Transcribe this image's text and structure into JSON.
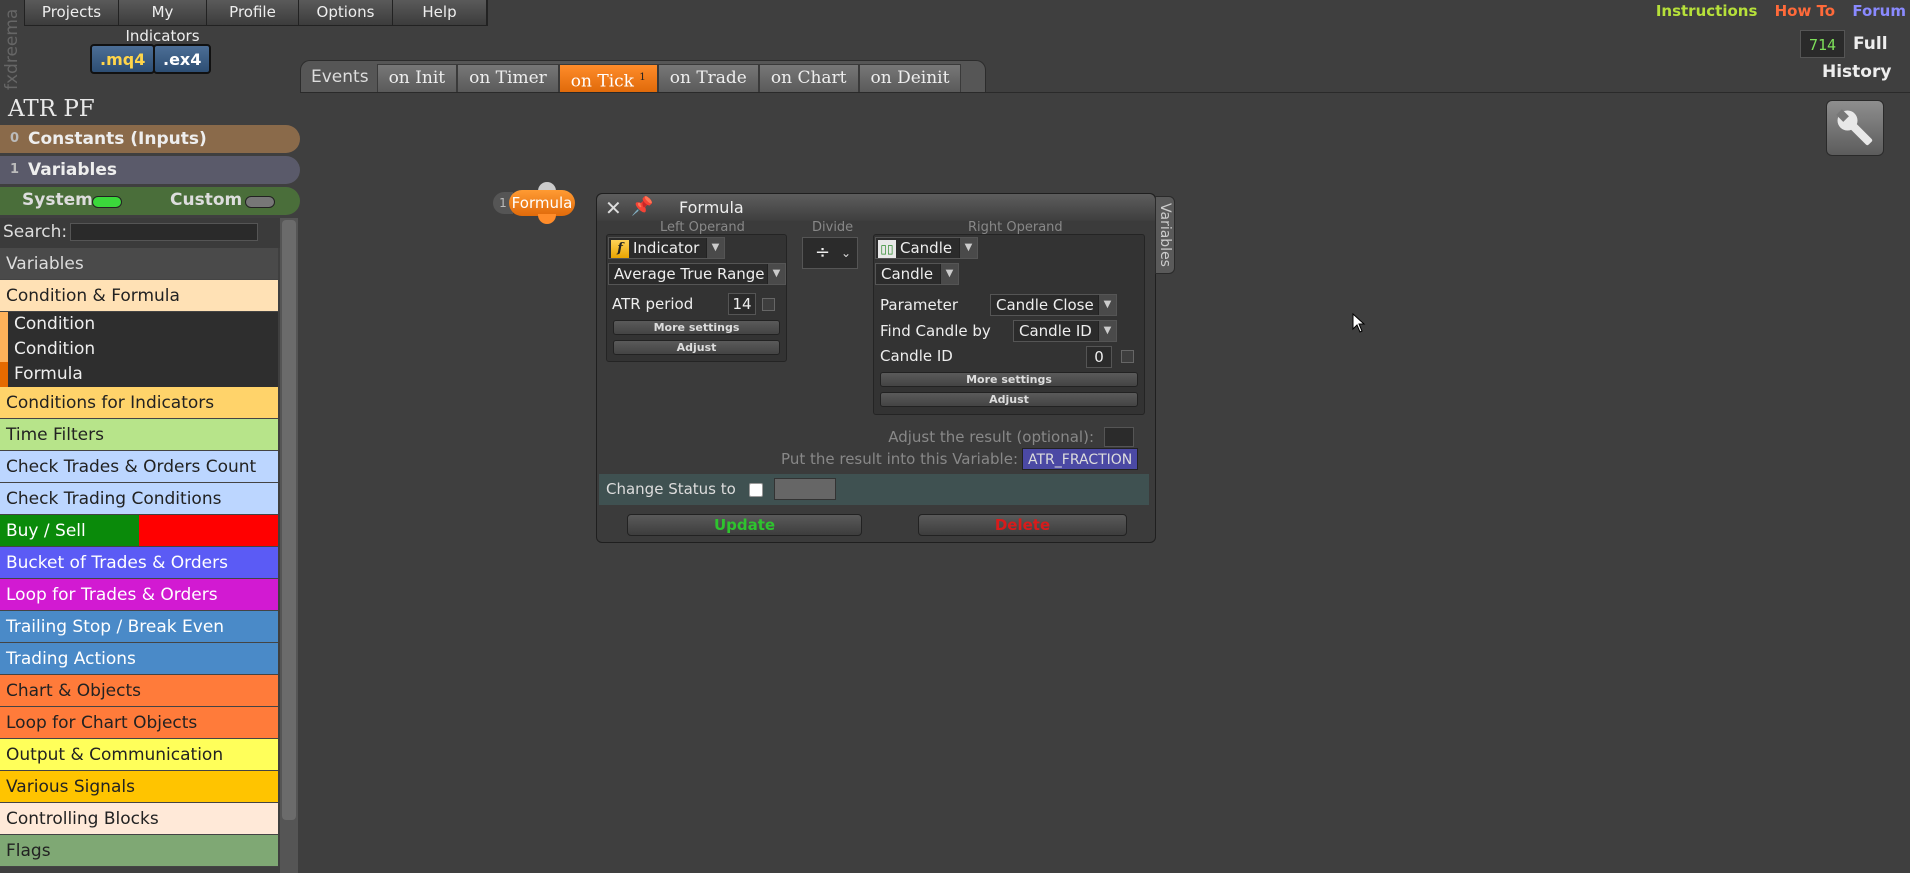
{
  "menu": [
    "Projects",
    "My Indicators",
    "Profile",
    "Options",
    "Help"
  ],
  "brand": "fxdreema",
  "file_buttons": {
    "mq4": ".mq4",
    "ex4": ".ex4"
  },
  "top_links": [
    {
      "label": "Instructions",
      "color": "#b6e03a"
    },
    {
      "label": "How To",
      "color": "#ff6a3a"
    },
    {
      "label": "Forum",
      "color": "#8a8aff"
    }
  ],
  "history": {
    "count": "714",
    "full_label": "Full",
    "label": "History"
  },
  "events": {
    "label": "Events",
    "tabs": [
      "on Init",
      "on Timer",
      "on Tick",
      "on Trade",
      "on Chart",
      "on Deinit"
    ],
    "active": "on Tick",
    "active_badge": "1"
  },
  "project": {
    "title": "ATR PF"
  },
  "left": {
    "constants": {
      "count": "0",
      "label": "Constants (Inputs)"
    },
    "variables": {
      "count": "1",
      "label": "Variables"
    },
    "system_label": "System",
    "custom_label": "Custom",
    "search_label": "Search:",
    "categories": [
      {
        "label": "Variables",
        "color": "#4a4a4a",
        "text": "#ddd"
      },
      {
        "label": "Condition & Formula",
        "color": "#ffe1b5",
        "text": "#222"
      },
      {
        "label": "Conditions for Indicators",
        "color": "#ffd36a",
        "text": "#222"
      },
      {
        "label": "Time Filters",
        "color": "#b7e48a",
        "text": "#222"
      },
      {
        "label": "Check Trades & Orders Count",
        "color": "#bcd6ff",
        "text": "#222"
      },
      {
        "label": "Check Trading Conditions",
        "color": "#bcd6ff",
        "text": "#222"
      },
      {
        "label": "Buy / Sell",
        "color": "#0a8a0a",
        "text": "#fff"
      },
      {
        "label": "Bucket of Trades & Orders",
        "color": "#5b5bf5",
        "text": "#fff"
      },
      {
        "label": "Loop for Trades & Orders",
        "color": "#d21ad2",
        "text": "#fff"
      },
      {
        "label": "Trailing Stop / Break Even",
        "color": "#4a8ac8",
        "text": "#fff"
      },
      {
        "label": "Trading Actions",
        "color": "#4a8ac8",
        "text": "#fff"
      },
      {
        "label": "Chart & Objects",
        "color": "#ff7b3a",
        "text": "#222"
      },
      {
        "label": "Loop for Chart Objects",
        "color": "#ff7b3a",
        "text": "#222"
      },
      {
        "label": "Output & Communication",
        "color": "#ffff5a",
        "text": "#222"
      },
      {
        "label": "Various Signals",
        "color": "#ffc400",
        "text": "#222"
      },
      {
        "label": "Controlling Blocks",
        "color": "#ffe9d8",
        "text": "#222"
      },
      {
        "label": "Flags",
        "color": "#7fa874",
        "text": "#222"
      }
    ],
    "sub_items": [
      "Condition",
      "Condition",
      "Formula"
    ]
  },
  "node": {
    "number": "1",
    "label": "Formula"
  },
  "dialog": {
    "title": "Formula",
    "vars_tab": "Variables",
    "left_operand": {
      "header": "Left Operand",
      "type": "Indicator",
      "indicator": "Average True Range",
      "param_label": "ATR period",
      "param_value": "14",
      "more_settings": "More settings",
      "adjust": "Adjust"
    },
    "operator": {
      "header": "Divide",
      "symbol": "÷"
    },
    "right_operand": {
      "header": "Right Operand",
      "type": "Candle",
      "sub_type": "Candle",
      "parameter_label": "Parameter",
      "parameter_value": "Candle Close",
      "find_label": "Find Candle by",
      "find_value": "Candle ID",
      "id_label": "Candle ID",
      "id_value": "0",
      "more_settings": "More settings",
      "adjust": "Adjust"
    },
    "adjust_result_label": "Adjust the result (optional):",
    "put_result_label": "Put the result into this Variable:",
    "result_variable": "ATR_FRACTION",
    "status_label": "Change Status to",
    "update_label": "Update",
    "delete_label": "Delete"
  }
}
